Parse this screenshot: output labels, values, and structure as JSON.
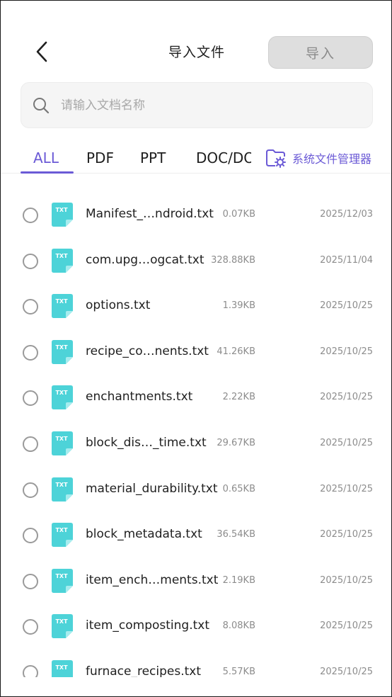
{
  "header": {
    "title": "导入文件",
    "import_label": "导入"
  },
  "search": {
    "placeholder": "请输入文档名称"
  },
  "tabs": [
    {
      "label": "ALL",
      "active": true
    },
    {
      "label": "PDF",
      "active": false
    },
    {
      "label": "PPT",
      "active": false
    },
    {
      "label": "DOC/DOCX",
      "active": false
    }
  ],
  "file_manager": {
    "label": "系统文件管理器",
    "icon": "folder-gear-icon"
  },
  "colors": {
    "accent": "#6b5ad6",
    "txt_icon": "#4dd3d8",
    "button_bg": "#dedede"
  },
  "files": [
    {
      "name": "Manifest_…ndroid.txt",
      "size": "0.07KB",
      "date": "2025/12/03",
      "icon_label": "TXT"
    },
    {
      "name": "com.upg…ogcat.txt",
      "size": "328.88KB",
      "date": "2025/11/04",
      "icon_label": "TXT"
    },
    {
      "name": "options.txt",
      "size": "1.39KB",
      "date": "2025/10/25",
      "icon_label": "TXT"
    },
    {
      "name": "recipe_co…nents.txt",
      "size": "41.26KB",
      "date": "2025/10/25",
      "icon_label": "TXT"
    },
    {
      "name": "enchantments.txt",
      "size": "2.22KB",
      "date": "2025/10/25",
      "icon_label": "TXT"
    },
    {
      "name": "block_dis…_time.txt",
      "size": "29.67KB",
      "date": "2025/10/25",
      "icon_label": "TXT"
    },
    {
      "name": "material_durability.txt",
      "size": "0.65KB",
      "date": "2025/10/25",
      "icon_label": "TXT"
    },
    {
      "name": "block_metadata.txt",
      "size": "36.54KB",
      "date": "2025/10/25",
      "icon_label": "TXT"
    },
    {
      "name": "item_ench…ments.txt",
      "size": "2.19KB",
      "date": "2025/10/25",
      "icon_label": "TXT"
    },
    {
      "name": "item_composting.txt",
      "size": "8.08KB",
      "date": "2025/10/25",
      "icon_label": "TXT"
    },
    {
      "name": "furnace_recipes.txt",
      "size": "5.57KB",
      "date": "2025/10/25",
      "icon_label": "TXT"
    }
  ]
}
